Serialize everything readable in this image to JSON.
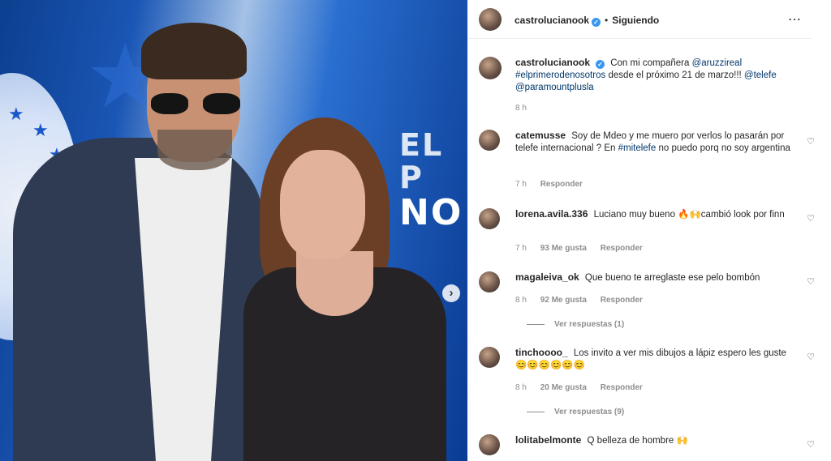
{
  "post": {
    "author": "castrolucianook",
    "follow_status": "Siguiendo",
    "separator": "•",
    "more_icon": "⋯",
    "caption": {
      "prefix": "Con mi compañera",
      "mention1": "@aruzzireal",
      "hashtag": "#elprimerodenosotros",
      "middle": "desde el próximo 21 de marzo!!!",
      "mention2": "@telefe",
      "mention3": "@paramountplusla",
      "time": "8 h"
    },
    "photo": {
      "sign_line1": "EL P",
      "sign_line2": "NO",
      "next_icon": "›"
    }
  },
  "comments": [
    {
      "user": "catemusse",
      "text_before": "Soy de Mdeo y me muero por verlos lo pasarán por telefe internacional ? En",
      "hashtag": "#mitelefe",
      "text_after": "no puedo porq no soy argentina",
      "time": "7 h",
      "likes": "",
      "reply": "Responder"
    },
    {
      "user": "lorena.avila.336",
      "text": "Luciano muy bueno 🔥🙌cambió look por finn",
      "time": "7 h",
      "likes": "93 Me gusta",
      "reply": "Responder"
    },
    {
      "user": "magaleiva_ok",
      "text": "Que bueno te arreglaste ese pelo bombón",
      "time": "8 h",
      "likes": "92 Me gusta",
      "reply": "Responder",
      "view_replies": "Ver respuestas (1)"
    },
    {
      "user": "tinchoooo_",
      "text": "Los invito a ver mis dibujos a lápiz espero les guste 😊😊😊😊😊😊",
      "time": "8 h",
      "likes": "20 Me gusta",
      "reply": "Responder",
      "view_replies": "Ver respuestas (9)"
    },
    {
      "user": "lolitabelmonte",
      "text": "Q belleza de hombre 🙌",
      "time": "",
      "likes": "",
      "reply": ""
    }
  ],
  "icons": {
    "heart": "♡",
    "verified": "✓",
    "star": "★"
  },
  "colors": {
    "link": "#00376b",
    "muted": "#8e8e8e",
    "verified": "#3897f0"
  }
}
